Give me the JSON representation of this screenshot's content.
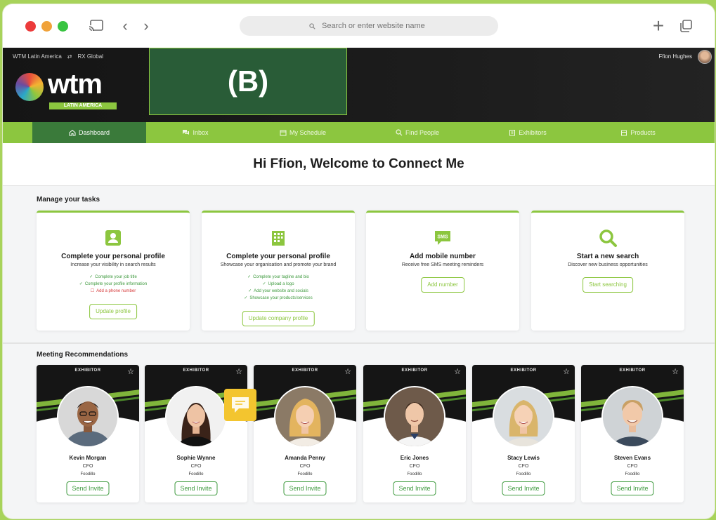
{
  "browser": {
    "url_placeholder": "Search or enter website name"
  },
  "header": {
    "topbar_left": [
      "WTM Latin America",
      "RX Global"
    ],
    "user_name": "Ffion Hughes",
    "logo_text": "wtm",
    "logo_sub": "LATIN AMERICA",
    "overlay_label": "(B)"
  },
  "nav": {
    "items": [
      {
        "label": "Dashboard",
        "icon": "home-icon"
      },
      {
        "label": "Inbox",
        "icon": "chat-icon"
      },
      {
        "label": "My Schedule",
        "icon": "calendar-icon"
      },
      {
        "label": "Find People",
        "icon": "search-icon"
      },
      {
        "label": "Exhibitors",
        "icon": "building-icon"
      },
      {
        "label": "Products",
        "icon": "box-icon"
      }
    ]
  },
  "welcome": "Hi Ffion, Welcome to Connect Me",
  "tasks": {
    "title": "Manage your tasks",
    "cards": [
      {
        "title": "Complete your personal profile",
        "subtitle": "Increase your visibility in search results",
        "checklist": [
          {
            "text": "Complete your job title",
            "done": true
          },
          {
            "text": "Complete your profile information",
            "done": true
          },
          {
            "text": "Add a phone number",
            "done": false
          }
        ],
        "button": "Update profile"
      },
      {
        "title": "Complete your personal profile",
        "subtitle": "Showcase your organisation and promote your brand",
        "checklist": [
          {
            "text": "Complete your tagline and bio",
            "done": true
          },
          {
            "text": "Upload a logo",
            "done": true
          },
          {
            "text": "Add your website and socials",
            "done": true
          },
          {
            "text": "Showcase your products/services",
            "done": true
          }
        ],
        "button": "Update company profile"
      },
      {
        "title": "Add mobile number",
        "subtitle": "Receive free SMS meeting reminders",
        "checklist": [],
        "button": "Add number",
        "icon_text": "SMS"
      },
      {
        "title": "Start a new search",
        "subtitle": "Discover new business opportunities",
        "checklist": [],
        "button": "Start searching"
      }
    ]
  },
  "meetings": {
    "title": "Meeting Recommendations",
    "people": [
      {
        "badge": "EXHIBITOR",
        "name": "Kevin Morgan",
        "role": "CFO",
        "company": "Foodillo",
        "button": "Send Invite"
      },
      {
        "badge": "EXHIBITOR",
        "name": "Sophie Wynne",
        "role": "CFO",
        "company": "Foodillo",
        "button": "Send Invite"
      },
      {
        "badge": "EXHIBITOR",
        "name": "Amanda Penny",
        "role": "CFO",
        "company": "Foodillo",
        "button": "Send Invite"
      },
      {
        "badge": "EXHIBITOR",
        "name": "Eric Jones",
        "role": "CFO",
        "company": "Foodillo",
        "button": "Send Invite"
      },
      {
        "badge": "EXHIBITOR",
        "name": "Stacy Lewis",
        "role": "CFO",
        "company": "Foodillo",
        "button": "Send Invite"
      },
      {
        "badge": "EXHIBITOR",
        "name": "Steven Evans",
        "role": "CFO",
        "company": "Foodillo",
        "button": "Send Invite"
      }
    ]
  },
  "colors": {
    "accent_green": "#8cc63f",
    "dark_green": "#3a7a3a",
    "header_dark": "#151515",
    "overlay_green": "#295c37",
    "chat_yellow": "#f3c52f"
  }
}
